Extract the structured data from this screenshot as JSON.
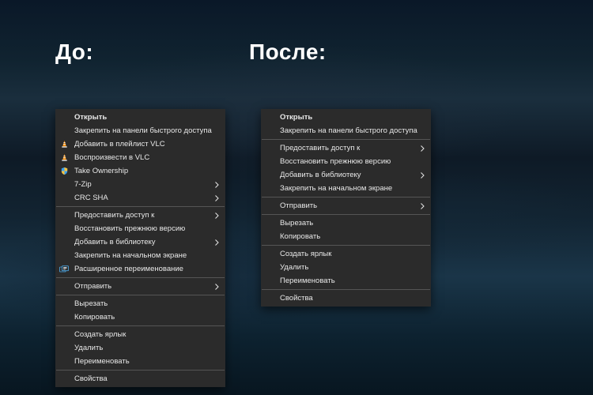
{
  "labels": {
    "before": "До:",
    "after": "После:"
  },
  "colors": {
    "menu_bg": "#2b2b2b",
    "menu_text": "#e8e8e8",
    "vlc_orange": "#ff8c00",
    "shield_blue": "#3aa0f0",
    "shield_yellow": "#f9c23c"
  },
  "menu_before": {
    "groups": [
      [
        {
          "label": "Открыть",
          "bold": true
        },
        {
          "label": "Закрепить на панели быстрого доступа"
        },
        {
          "label": "Добавить в плейлист VLC",
          "icon": "vlc"
        },
        {
          "label": "Воспроизвести в VLC",
          "icon": "vlc"
        },
        {
          "label": "Take Ownership",
          "icon": "shield"
        },
        {
          "label": "7-Zip",
          "submenu": true
        },
        {
          "label": "CRC SHA",
          "submenu": true
        }
      ],
      [
        {
          "label": "Предоставить доступ к",
          "submenu": true
        },
        {
          "label": "Восстановить прежнюю версию"
        },
        {
          "label": "Добавить в библиотеку",
          "submenu": true
        },
        {
          "label": "Закрепить на начальном экране"
        },
        {
          "label": "Расширенное переименование",
          "icon": "rename"
        }
      ],
      [
        {
          "label": "Отправить",
          "submenu": true
        }
      ],
      [
        {
          "label": "Вырезать"
        },
        {
          "label": "Копировать"
        }
      ],
      [
        {
          "label": "Создать ярлык"
        },
        {
          "label": "Удалить"
        },
        {
          "label": "Переименовать"
        }
      ],
      [
        {
          "label": "Свойства"
        }
      ]
    ]
  },
  "menu_after": {
    "groups": [
      [
        {
          "label": "Открыть",
          "bold": true
        },
        {
          "label": "Закрепить на панели быстрого доступа"
        }
      ],
      [
        {
          "label": "Предоставить доступ к",
          "submenu": true
        },
        {
          "label": "Восстановить прежнюю версию"
        },
        {
          "label": "Добавить в библиотеку",
          "submenu": true
        },
        {
          "label": "Закрепить на начальном экране"
        }
      ],
      [
        {
          "label": "Отправить",
          "submenu": true
        }
      ],
      [
        {
          "label": "Вырезать"
        },
        {
          "label": "Копировать"
        }
      ],
      [
        {
          "label": "Создать ярлык"
        },
        {
          "label": "Удалить"
        },
        {
          "label": "Переименовать"
        }
      ],
      [
        {
          "label": "Свойства"
        }
      ]
    ]
  }
}
